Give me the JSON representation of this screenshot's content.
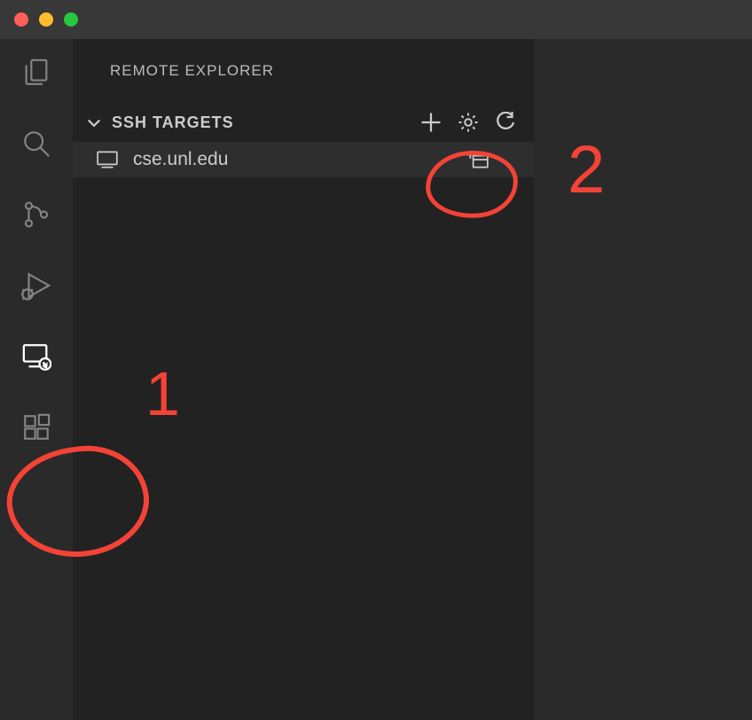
{
  "sidebar": {
    "title": "REMOTE EXPLORER",
    "section": {
      "label": "SSH TARGETS"
    },
    "targets": [
      {
        "host": "cse.unl.edu"
      }
    ]
  },
  "annotations": {
    "label1": "1",
    "label2": "2"
  }
}
